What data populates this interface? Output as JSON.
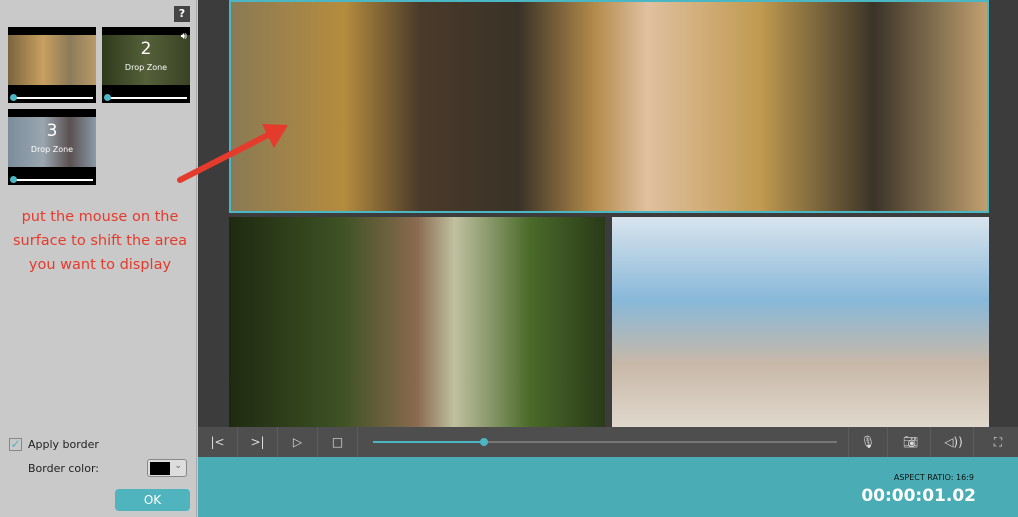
{
  "left_panel": {
    "help_label": "?",
    "thumbnails": [
      {
        "number": "",
        "label": "",
        "progress": 0
      },
      {
        "number": "2",
        "label": "Drop Zone",
        "progress": 0,
        "icon": "speaker-icon"
      },
      {
        "number": "3",
        "label": "Drop Zone",
        "progress": 0
      }
    ],
    "hint": "put the mouse on the surface to shift the area you want to display",
    "apply_border_label": "Apply border",
    "apply_border_checked": true,
    "border_color_label": "Border color:",
    "border_color": "#000000",
    "ok_label": "OK"
  },
  "controls": {
    "buttons": [
      "skip-back-icon",
      "skip-forward-icon",
      "play-icon",
      "stop-icon"
    ],
    "progress_percent": 24,
    "right_buttons": [
      "microphone-icon",
      "camera-icon",
      "volume-icon",
      "fullscreen-icon"
    ]
  },
  "footer": {
    "aspect_ratio": "ASPECT RATIO: 16:9",
    "timecode": "00:00:01.02"
  },
  "colors": {
    "accent": "#4cb7c4",
    "footer": "#4aadb5",
    "hint": "#e53b2c"
  }
}
